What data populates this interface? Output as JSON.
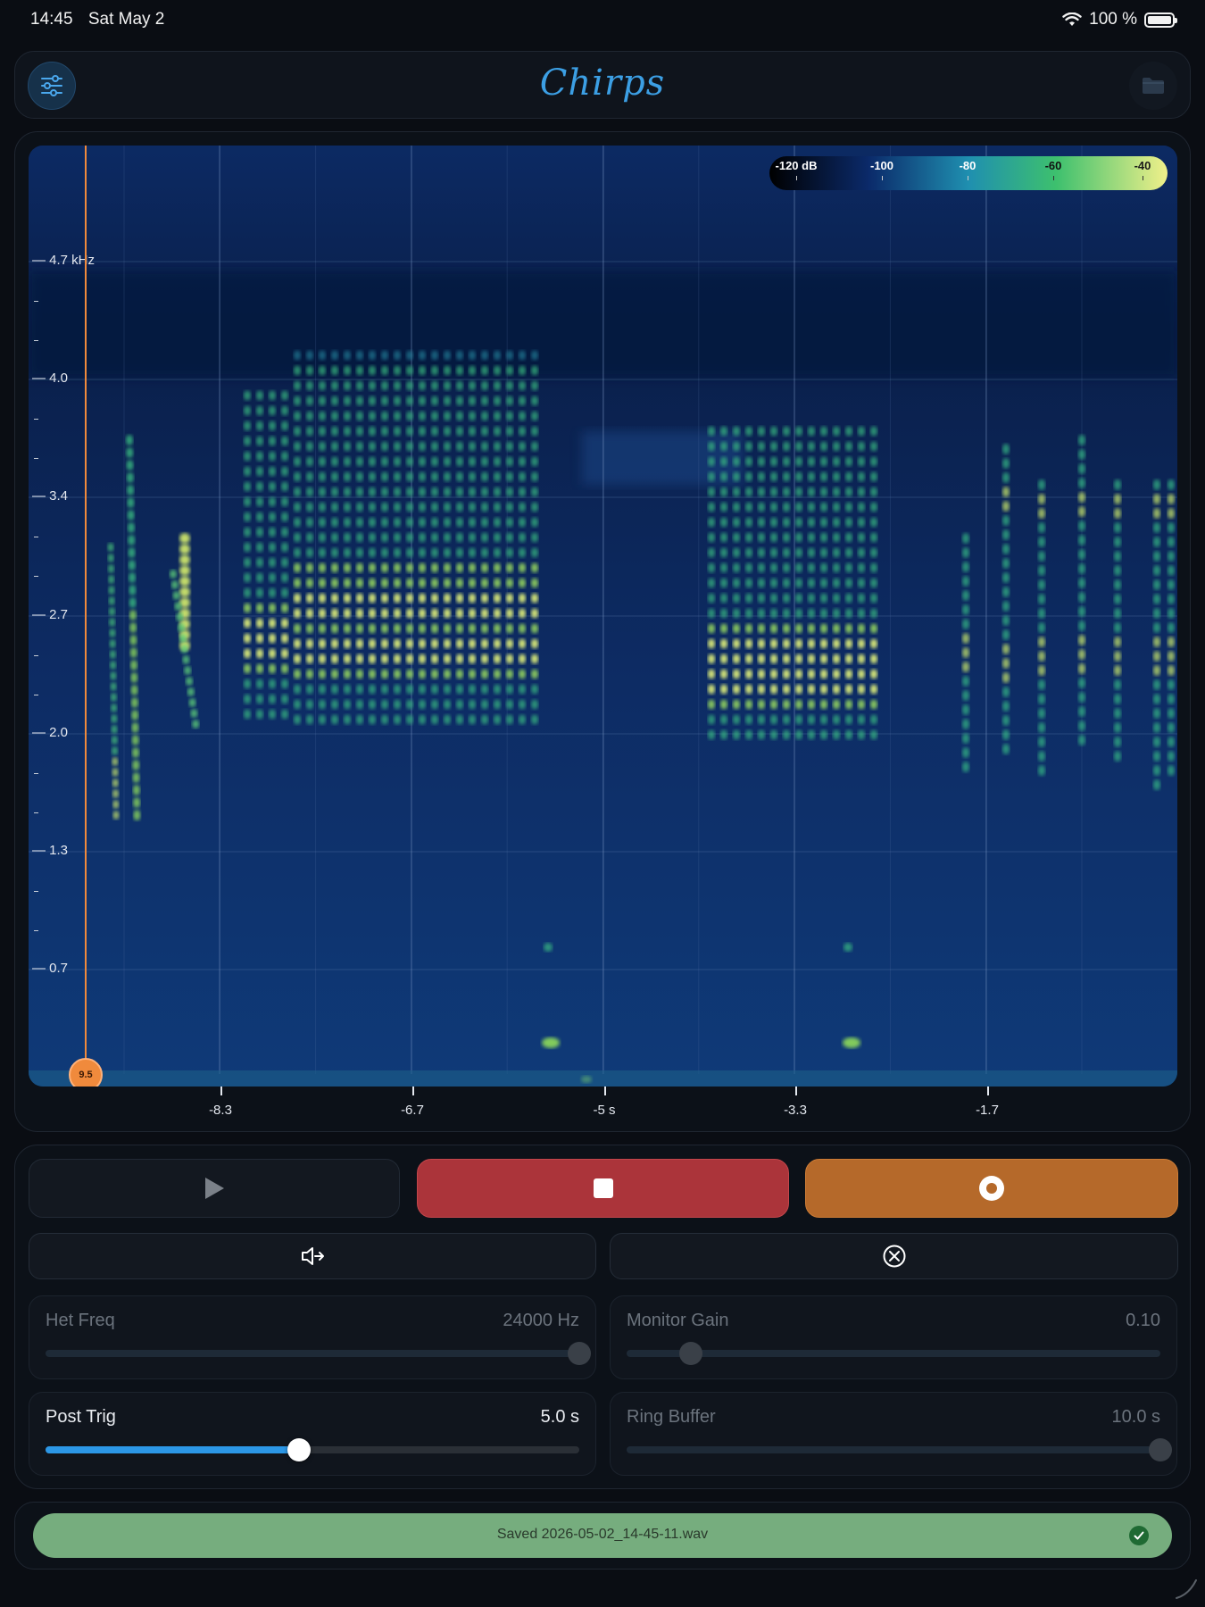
{
  "status_bar": {
    "time": "14:45",
    "date": "Sat May 2",
    "battery": "100 %"
  },
  "header": {
    "title": "Chirps",
    "settings_icon": "sliders-icon",
    "folder_icon": "folder-icon"
  },
  "spectrogram": {
    "y_axis_labels": [
      "4.7 kHz",
      "4.0",
      "3.4",
      "2.7",
      "2.0",
      "1.3",
      "0.7"
    ],
    "x_axis_labels": [
      "-8.3",
      "-6.7",
      "-5 s",
      "-3.3",
      "-1.7"
    ],
    "colorbar_labels": [
      "-120 dB",
      "-100",
      "-80",
      "-60",
      "-40"
    ],
    "marker_label": "9.5",
    "colors": {
      "background": "#0c2558",
      "peak": "#d7f06a",
      "mid": "#2fb58f",
      "cursor": "#f0873a"
    }
  },
  "controls": {
    "play_icon": "play-icon",
    "stop_icon": "stop-icon",
    "record_icon": "record-icon",
    "monitor_icon": "speaker-arrow-icon",
    "clear_icon": "circle-x-icon",
    "sliders": {
      "het_freq": {
        "label": "Het Freq",
        "value": "24000 Hz",
        "level": 1.0,
        "enabled": false
      },
      "monitor_gain": {
        "label": "Monitor Gain",
        "value": "0.10",
        "level": 0.12,
        "enabled": false
      },
      "post_trig": {
        "label": "Post Trig",
        "value": "5.0 s",
        "level": 0.475,
        "enabled": true
      },
      "ring_buffer": {
        "label": "Ring Buffer",
        "value": "10.0 s",
        "level": 1.0,
        "enabled": false
      }
    }
  },
  "status": {
    "message": "Saved 2026-05-02_14-45-11.wav",
    "icon": "check-circle-icon"
  }
}
